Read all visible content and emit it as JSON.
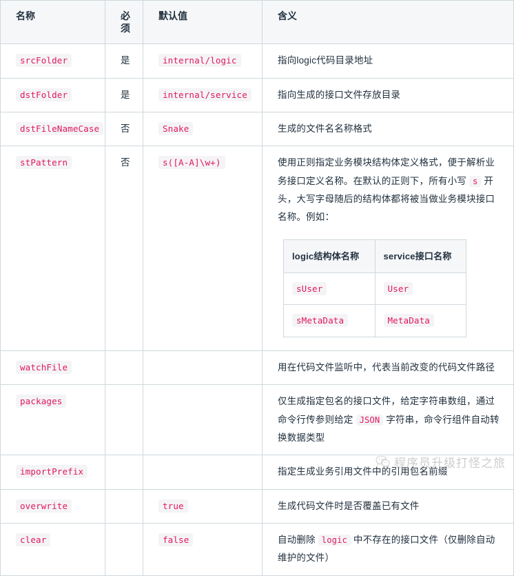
{
  "table": {
    "headers": [
      "名称",
      "必须",
      "默认值",
      "含义"
    ],
    "rows": [
      {
        "name": "srcFolder",
        "required": "是",
        "default": "internal/logic",
        "meaning_pre": "指向logic代码目录地址"
      },
      {
        "name": "dstFolder",
        "required": "是",
        "default": "internal/service",
        "meaning_pre": "指向生成的接口文件存放目录"
      },
      {
        "name": "dstFileNameCase",
        "required": "否",
        "default": "Snake",
        "meaning_pre": "生成的文件名名称格式"
      },
      {
        "name": "stPattern",
        "required": "否",
        "default": "s([A-A]\\w+)",
        "meaning_part1": "使用正则指定业务模块结构体定义格式，便于解析业务接口定义名称。在默认的正则下，所有小写 ",
        "meaning_code": "s",
        "meaning_part2": " 开头，大写字母随后的结构体都将被当做业务模块接口名称。例如："
      },
      {
        "name": "watchFile",
        "required": "",
        "default": "",
        "meaning_pre": "用在代码文件监听中，代表当前改变的代码文件路径"
      },
      {
        "name": "packages",
        "required": "",
        "default": "",
        "meaning_part1": "仅生成指定包名的接口文件，给定字符串数组，通过命令行传参则给定 ",
        "meaning_code": "JSON",
        "meaning_part2": " 字符串，命令行组件自动转换数据类型"
      },
      {
        "name": "importPrefix",
        "required": "",
        "default": "",
        "meaning_pre": "指定生成业务引用文件中的引用包名前缀"
      },
      {
        "name": "overwrite",
        "required": "",
        "default": "true",
        "meaning_pre": "生成代码文件时是否覆盖已有文件"
      },
      {
        "name": "clear",
        "required": "",
        "default": "false",
        "meaning_part1": "自动删除 ",
        "meaning_code": "logic",
        "meaning_part2": " 中不存在的接口文件（仅删除自动维护的文件）"
      }
    ]
  },
  "inner_table": {
    "headers": [
      "logic结构体名称",
      "service接口名称"
    ],
    "rows": [
      {
        "logic": "sUser",
        "service": "User"
      },
      {
        "logic": "sMetaData",
        "service": "MetaData"
      }
    ]
  },
  "watermark": {
    "text": "程序员升级打怪之旅",
    "icon": "wechat-icon"
  },
  "colors": {
    "code_text": "#e1195b",
    "code_bg": "#f4f4f6",
    "border": "#cfd8dc",
    "header_bg": "#f6f7f9",
    "body_text": "#22313f"
  }
}
